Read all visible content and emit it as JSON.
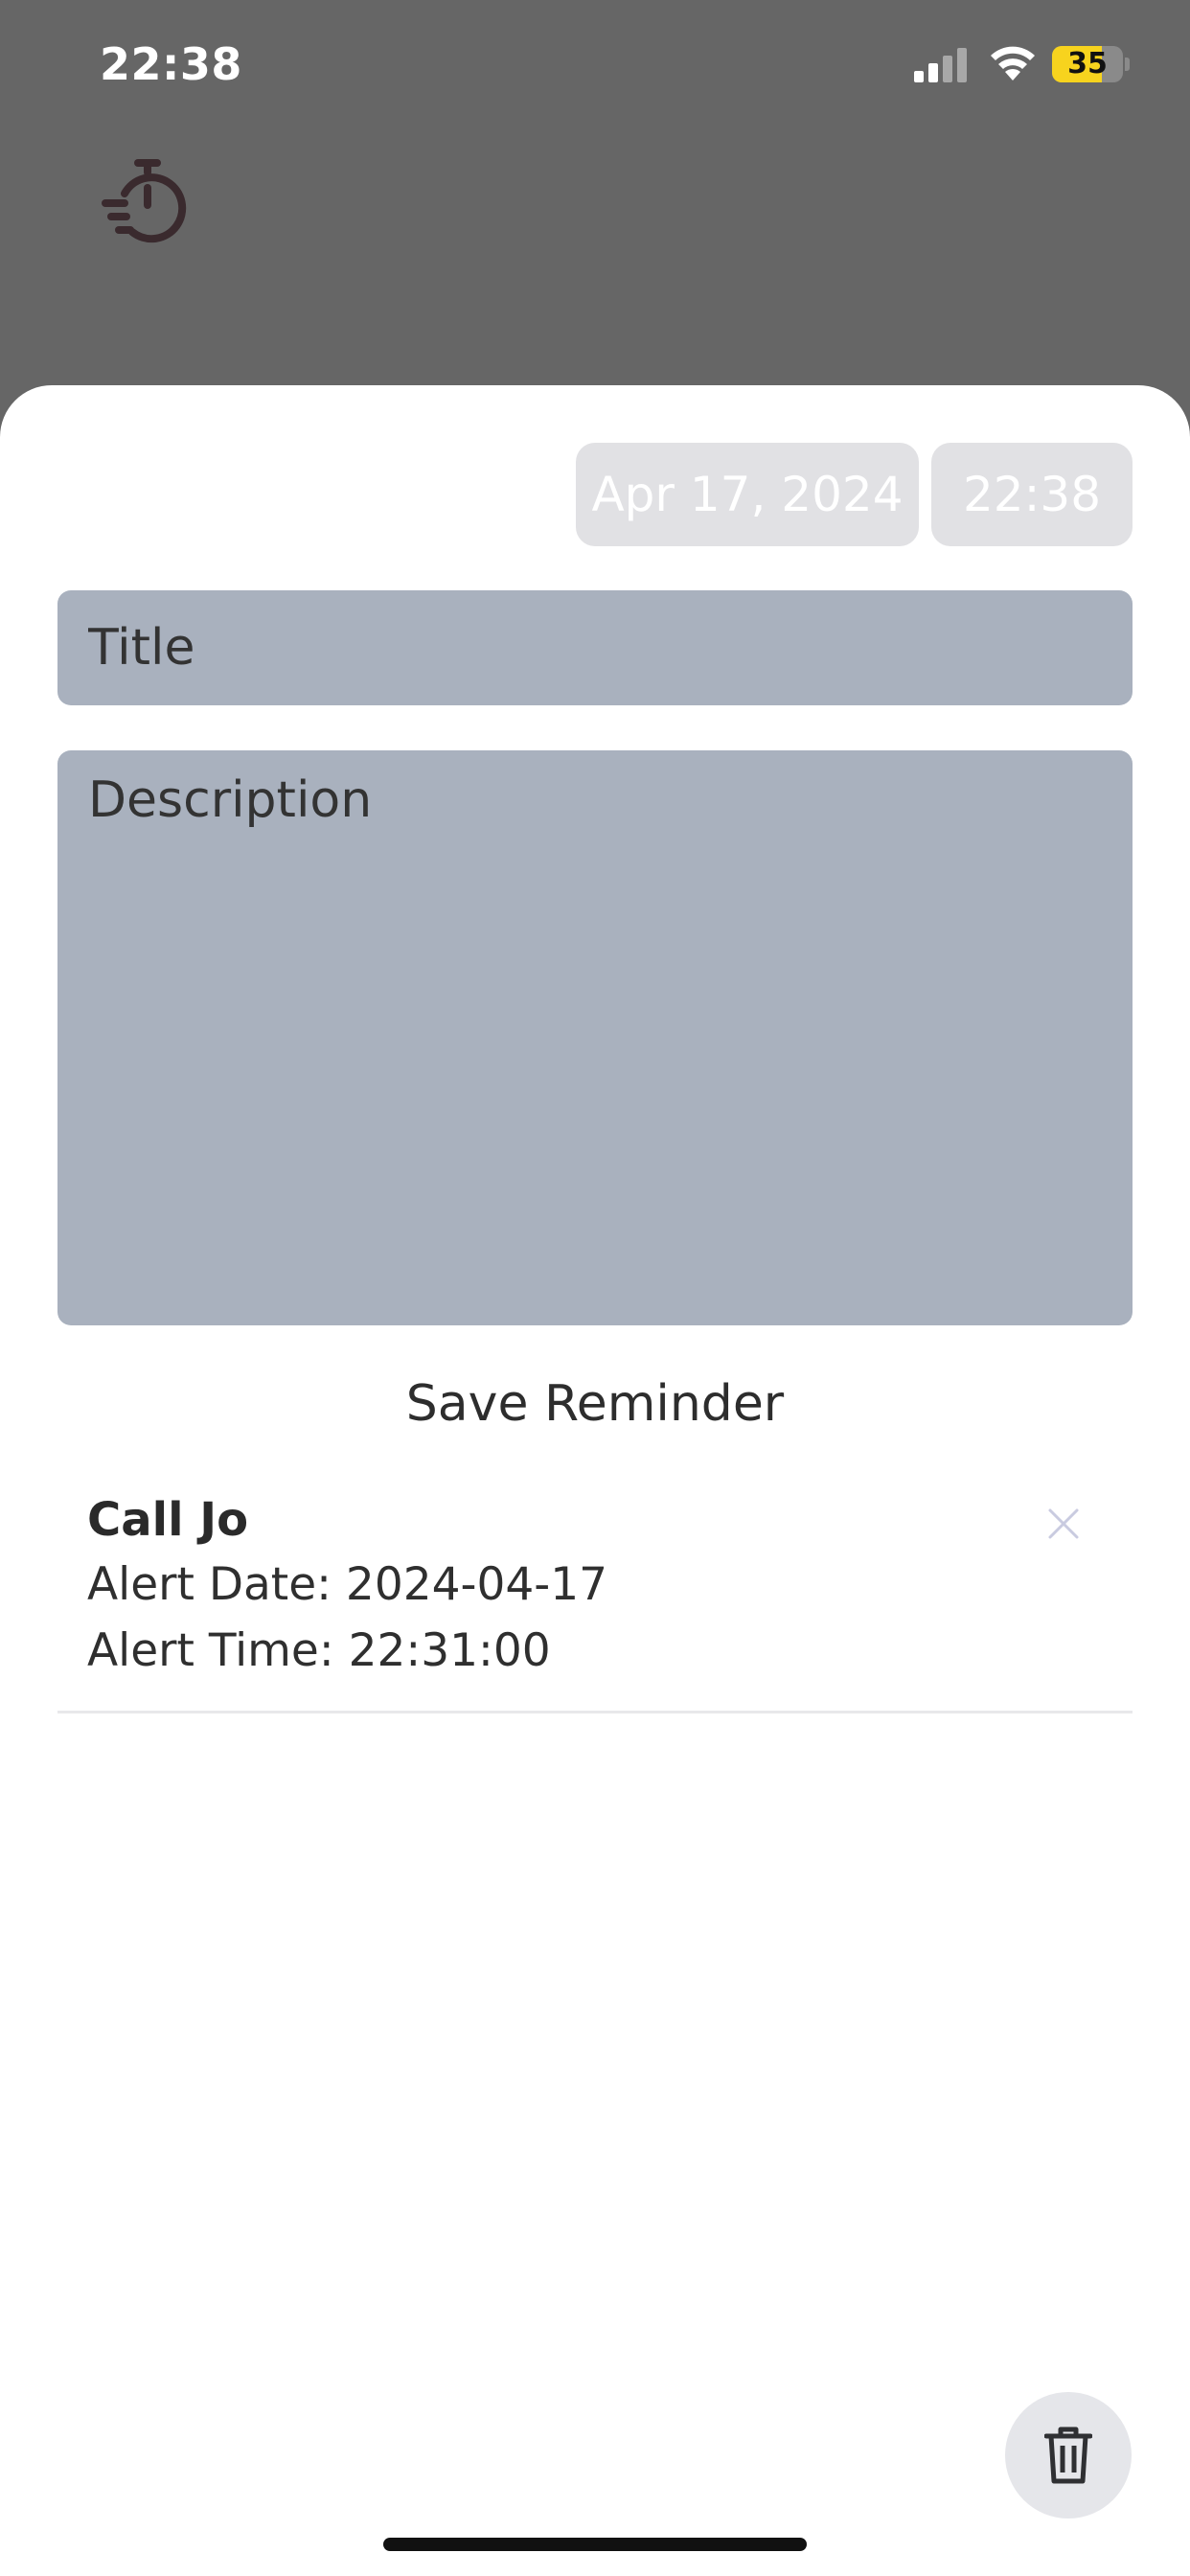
{
  "status_bar": {
    "time": "22:38",
    "battery_level": "35",
    "battery_fraction": 0.35
  },
  "header": {
    "icon": "stopwatch-icon"
  },
  "form": {
    "date_value": "Apr 17, 2024",
    "time_value": "22:38",
    "title_placeholder": "Title",
    "description_placeholder": "Description",
    "save_label": "Save Reminder"
  },
  "reminders": [
    {
      "title": "Call Jo",
      "alert_date": "Alert Date: 2024-04-17",
      "alert_time": "Alert Time: 22:31:00"
    }
  ],
  "icons": {
    "close": "close-icon",
    "delete": "trash-icon"
  },
  "colors": {
    "input_background": "#a9b1be",
    "chip_background": "#e1e1e4",
    "overlay": "#666666",
    "battery": "#f7d31e"
  }
}
